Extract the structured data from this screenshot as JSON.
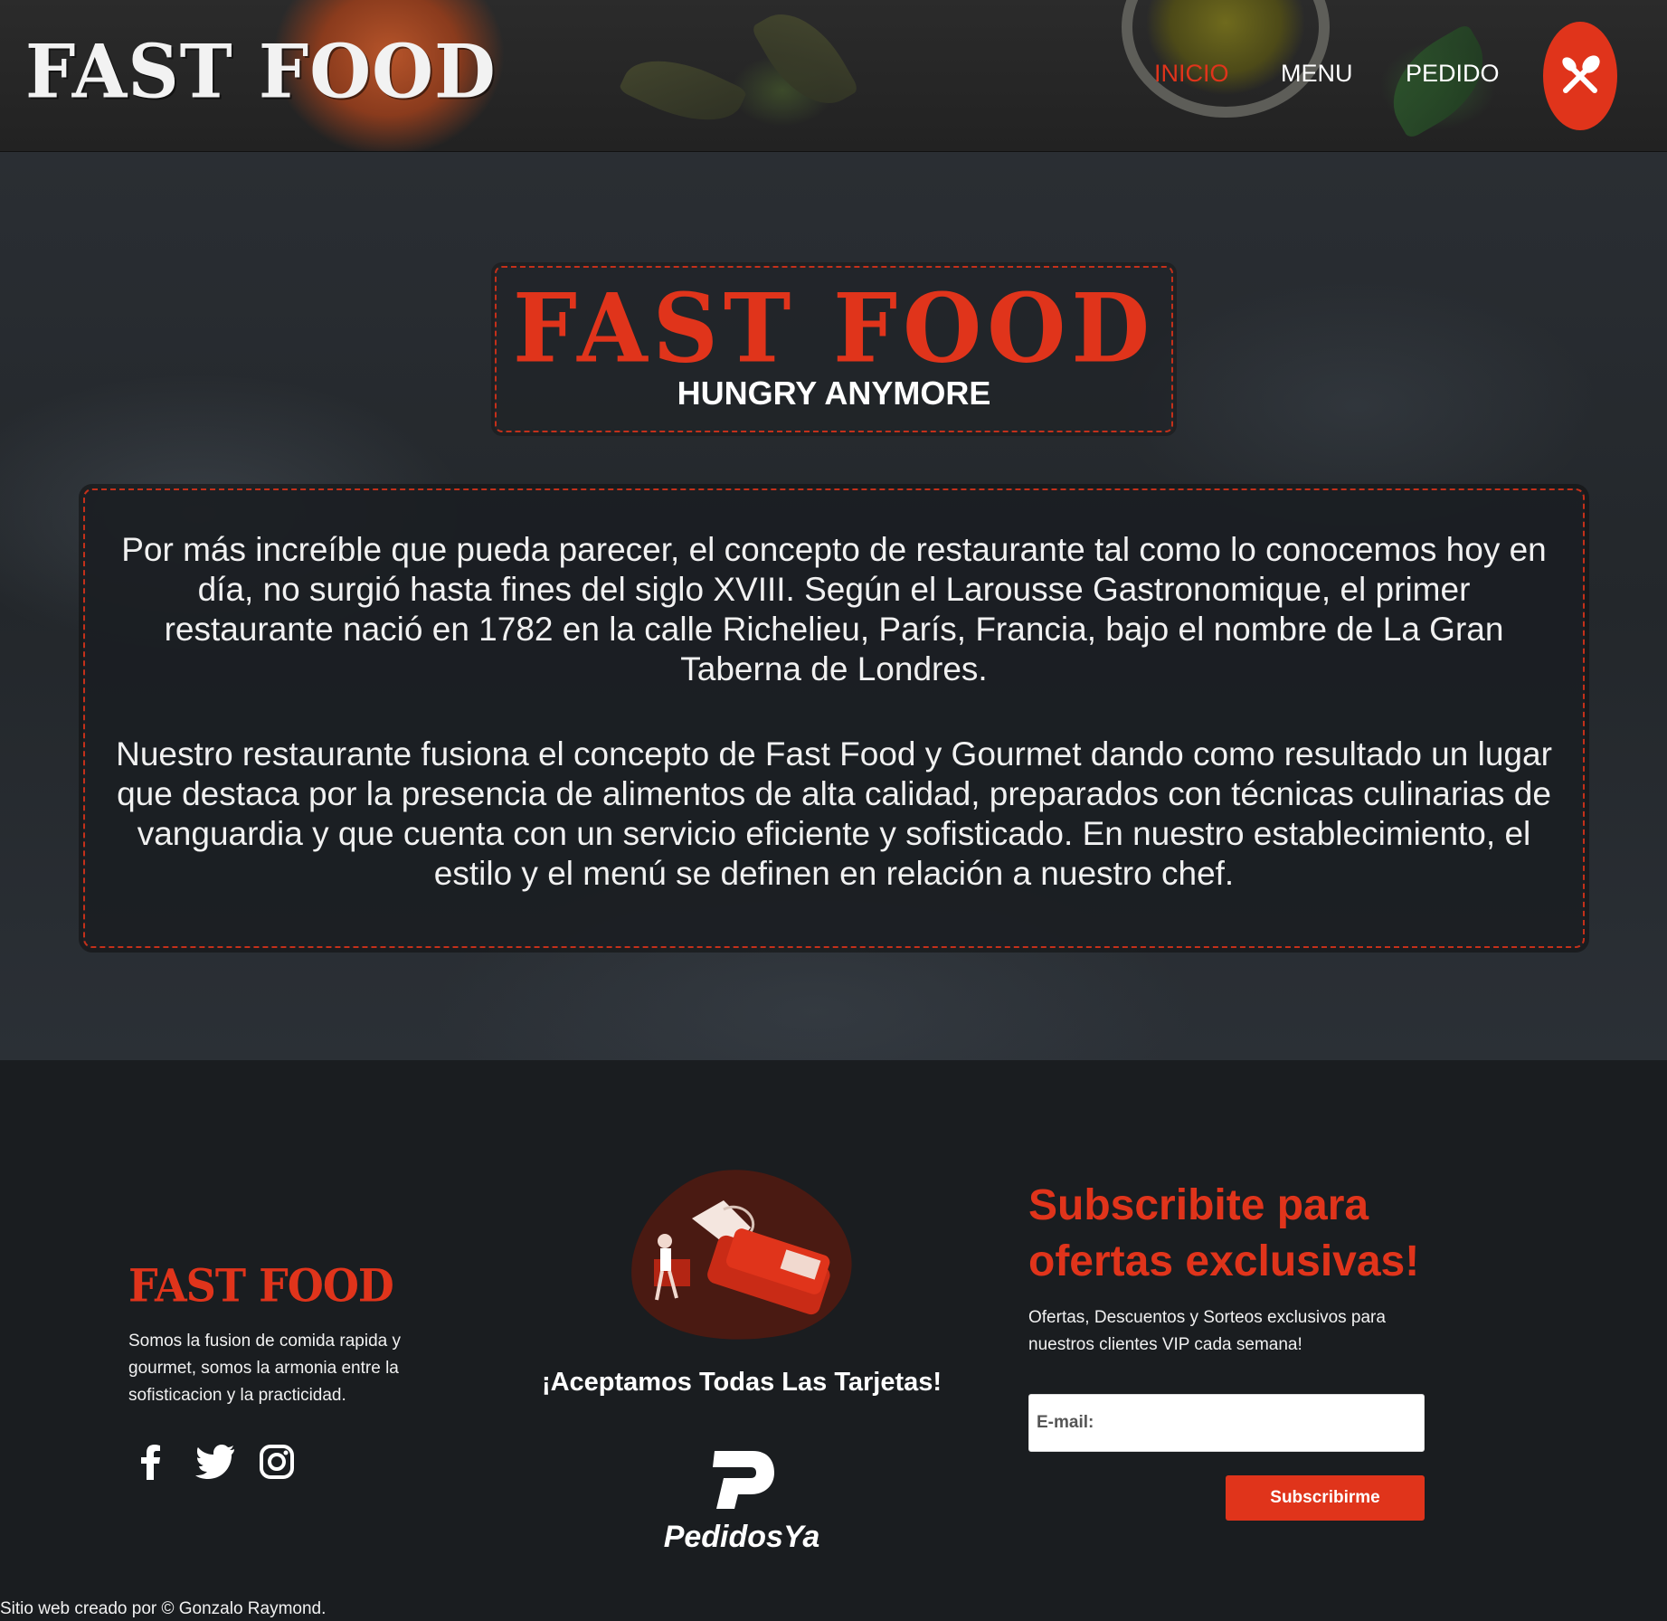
{
  "header": {
    "logo": "FAST FOOD",
    "nav": [
      {
        "label": "INICIO",
        "active": true
      },
      {
        "label": "MENU",
        "active": false
      },
      {
        "label": "PEDIDO",
        "active": false
      }
    ],
    "menu_icon": "fork-knife-icon"
  },
  "hero": {
    "title": "FAST FOOD",
    "subtitle": "HUNGRY ANYMORE",
    "paragraphs": [
      "Por más increíble que pueda parecer, el concepto de restaurante tal como lo conocemos hoy en día, no surgió hasta fines del siglo XVIII. Según el Larousse Gastronomique, el primer restaurante nació en 1782 en la calle Richelieu, París, Francia, bajo el nombre de La Gran Taberna de Londres.",
      "Nuestro restaurante fusiona el concepto de Fast Food y Gourmet dando como resultado un lugar que destaca por la presencia de alimentos de alta calidad, preparados con técnicas culinarias de vanguardia y que cuenta con un servicio eficiente y sofisticado. En nuestro establecimiento, el estilo y el menú se definen en relación a nuestro chef."
    ]
  },
  "footer": {
    "logo": "FAST FOOD",
    "about": "Somos la fusion de comida rapida y gourmet, somos la armonia entre la sofisticacion y la practicidad.",
    "socials": [
      "facebook-icon",
      "twitter-icon",
      "instagram-icon"
    ],
    "cards_text": "¡Aceptamos Todas Las Tarjetas!",
    "delivery_brand": "PedidosYa",
    "subscribe": {
      "title": "Subscribite para ofertas exclusivas!",
      "description": "Ofertas, Descuentos y Sorteos exclusivos para nuestros clientes VIP cada semana!",
      "email_placeholder": "E-mail:",
      "email_value": "",
      "button": "Subscribirme"
    },
    "credit": "Sitio web creado por © Gonzalo Raymond."
  },
  "colors": {
    "accent": "#e0341b",
    "background": "#1a1d20",
    "text": "#ffffff"
  }
}
